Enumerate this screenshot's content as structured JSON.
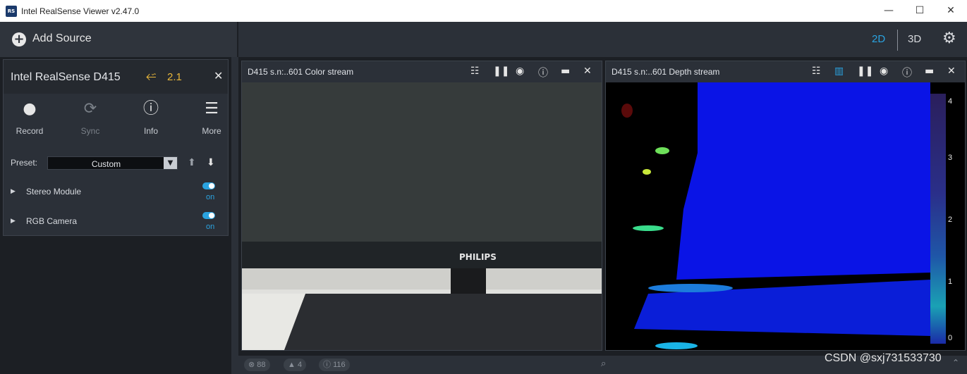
{
  "window": {
    "app_icon": "realsense-app-icon",
    "app_icon_text": "RS",
    "title": "Intel RealSense Viewer v2.47.0",
    "minimize": "—",
    "maximize": "☐",
    "close": "✕"
  },
  "topbar": {
    "add_source_label": "Add Source",
    "mode_2d": "2D",
    "mode_3d": "3D",
    "active_mode": "2D",
    "accent_color": "#2aa3e0"
  },
  "device": {
    "name": "Intel RealSense D415",
    "usb_version": "2.1",
    "usb_color": "#e8b63a",
    "tools": [
      {
        "label": "Record",
        "icon": "record-icon",
        "enabled": true
      },
      {
        "label": "Sync",
        "icon": "sync-icon",
        "enabled": false
      },
      {
        "label": "Info",
        "icon": "info-icon",
        "enabled": true
      },
      {
        "label": "More",
        "icon": "menu-icon",
        "enabled": true
      }
    ],
    "preset_label": "Preset:",
    "preset_value": "Custom",
    "modules": [
      {
        "label": "Stereo Module",
        "toggle": "on"
      },
      {
        "label": "RGB Camera",
        "toggle": "on"
      }
    ]
  },
  "streams": [
    {
      "title": "D415 s.n:..601 Color stream"
    },
    {
      "title": "D415 s.n:..601 Depth stream"
    }
  ],
  "depth_legend": {
    "labels": [
      "4",
      "3",
      "2",
      "1",
      "0"
    ]
  },
  "statusbar": {
    "errors": "88",
    "warnings": "4",
    "infos": "116"
  },
  "overlay": {
    "watermark": "CSDN @sxj731533730"
  }
}
